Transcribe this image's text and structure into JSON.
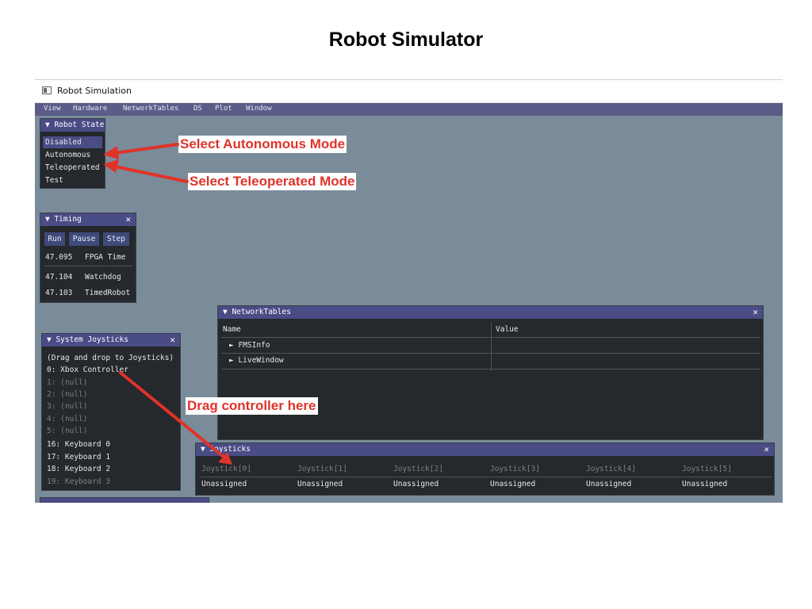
{
  "slide": {
    "title": "Robot Simulator"
  },
  "window": {
    "title": "Robot Simulation"
  },
  "menu": [
    "View",
    "Hardware",
    "NetworkTables",
    "DS",
    "Plot",
    "Window"
  ],
  "robot_state": {
    "title": "▼ Robot State",
    "items": [
      "Disabled",
      "Autonomous",
      "Teleoperated",
      "Test"
    ],
    "selected": "Disabled"
  },
  "timing": {
    "title": "▼ Timing",
    "close": "✕",
    "buttons": [
      "Run",
      "Pause",
      "Step"
    ],
    "rows": [
      {
        "value": "47.095",
        "label": "FPGA Time"
      },
      {
        "value": "47.104",
        "label": "Watchdog"
      },
      {
        "value": "47.103",
        "label": "TimedRobot"
      }
    ]
  },
  "system_joysticks": {
    "title": "▼ System Joysticks",
    "close": "✕",
    "hint": "(Drag and drop to Joysticks)",
    "items": [
      {
        "text": "0: Xbox Controller",
        "active": true
      },
      {
        "text": "1: (null)",
        "active": false
      },
      {
        "text": "2: (null)",
        "active": false
      },
      {
        "text": "3: (null)",
        "active": false
      },
      {
        "text": "4: (null)",
        "active": false
      },
      {
        "text": "5: (null)",
        "active": false
      },
      {
        "text": "16: Keyboard 0",
        "active": true
      },
      {
        "text": "17: Keyboard 1",
        "active": true
      },
      {
        "text": "18: Keyboard 2",
        "active": true
      },
      {
        "text": "19: Keyboard 3",
        "active": false
      }
    ]
  },
  "network_tables": {
    "title": "▼ NetworkTables",
    "close": "✕",
    "columns": [
      "Name",
      "Value"
    ],
    "rows": [
      "► FMSInfo",
      "► LiveWindow"
    ]
  },
  "joysticks": {
    "title": "▼ Joysticks",
    "close": "✕",
    "columns": [
      "Joystick[0]",
      "Joystick[1]",
      "Joystick[2]",
      "Joystick[3]",
      "Joystick[4]",
      "Joystick[5]"
    ],
    "values": [
      "Unassigned",
      "Unassigned",
      "Unassigned",
      "Unassigned",
      "Unassigned",
      "Unassigned"
    ]
  },
  "annotations": {
    "autonomous": "Select Autonomous Mode",
    "teleoperated": "Select Teleoperated Mode",
    "drag": "Drag controller here"
  },
  "colors": {
    "annotation": "#e0332a",
    "background": "#7a8c9a",
    "header": "#4a4c86"
  }
}
